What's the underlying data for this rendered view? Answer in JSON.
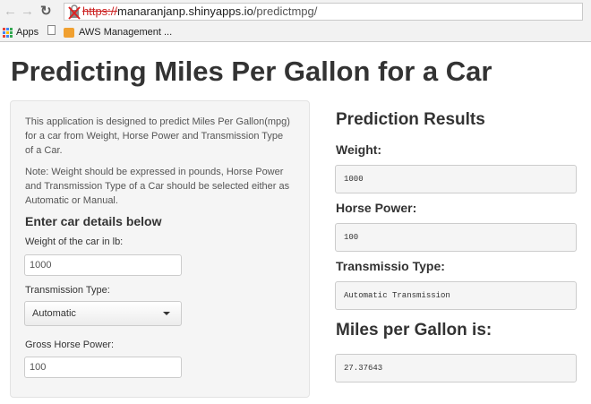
{
  "browser": {
    "url_protocol": "https://",
    "url_host": "manaranjanp.shinyapps.io",
    "url_path": "/predictmpg/",
    "bookmarks": [
      {
        "label": "Apps"
      },
      {
        "label": ""
      },
      {
        "label": "AWS Management ..."
      }
    ]
  },
  "page": {
    "title": "Predicting Miles Per Gallon for a Car"
  },
  "sidebar": {
    "description": "This application is designed to predict Miles Per Gallon(mpg) for a car from Weight, Horse Power and Transmission Type of a Car.",
    "note": "Note: Weight should be expressed in pounds, Horse Power and Transmission Type of a Car should be selected either as Automatic or Manual.",
    "heading": "Enter car details below",
    "weight_label": "Weight of the car in lb:",
    "weight_value": "1000",
    "transmission_label": "Transmission Type:",
    "transmission_value": "Automatic",
    "hp_label": "Gross Horse Power:",
    "hp_value": "100"
  },
  "results": {
    "title": "Prediction Results",
    "weight_label": "Weight:",
    "weight_output": "1000",
    "hp_label": "Horse Power:",
    "hp_output": "100",
    "transmission_label": "Transmissio Type:",
    "transmission_output": "Automatic Transmission",
    "mpg_label": "Miles per Gallon is:",
    "mpg_output": "27.37643"
  }
}
